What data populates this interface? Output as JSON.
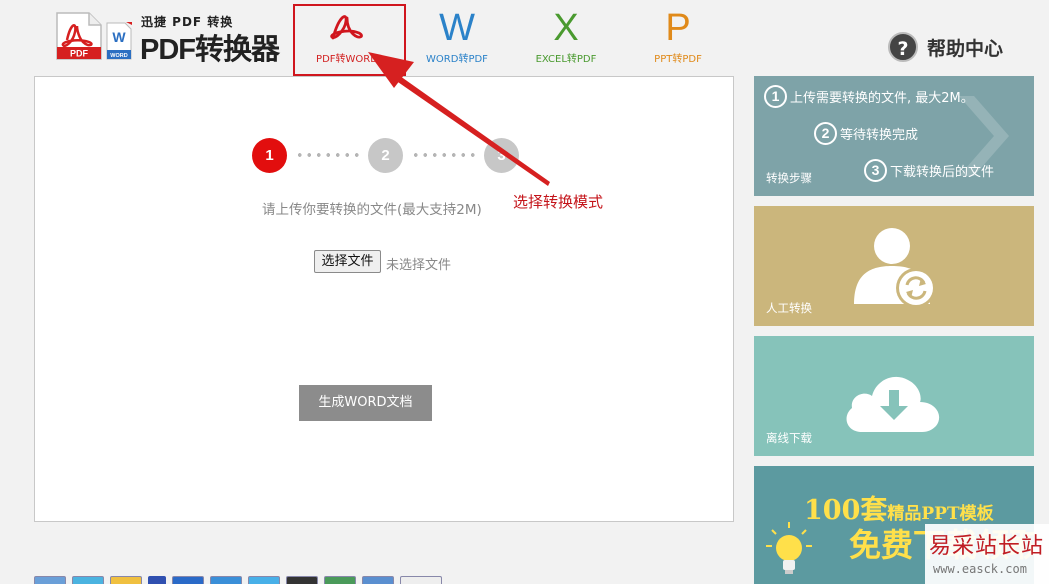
{
  "logo": {
    "subtitle": "迅捷 PDF 转换",
    "title": "PDF转换器",
    "pdf_badge": "PDF",
    "word_badge": "WORD"
  },
  "tabs": [
    {
      "glyph": "W",
      "label": "WORD转PDF"
    },
    {
      "glyph": "X",
      "label": "EXCEL转PDF"
    },
    {
      "glyph": "P",
      "label": "PPT转PDF"
    }
  ],
  "selected_tab": {
    "label": "PDF转WORD"
  },
  "help": {
    "icon_text": "?",
    "label": "帮助中心"
  },
  "steps": [
    "1",
    "2",
    "3"
  ],
  "upload": {
    "hint": "请上传你要转换的文件(最大支持2M)",
    "file_button": "选择文件",
    "file_status": "未选择文件",
    "generate_button": "生成WORD文档"
  },
  "annotation": "选择转换模式",
  "sidebar": {
    "steps_card": {
      "label": "转换步骤",
      "lines": [
        {
          "num": "1",
          "text": "上传需要转换的文件, 最大2M。"
        },
        {
          "num": "2",
          "text": "等待转换完成"
        },
        {
          "num": "3",
          "text": "下载转换后的文件"
        }
      ]
    },
    "manual_card": {
      "label": "人工转换"
    },
    "offline_card": {
      "label": "离线下载"
    },
    "promo_card": {
      "count": "100套",
      "small": "精品PPT模板",
      "big": "免费下载领取"
    }
  },
  "watermark": {
    "cn": "易采站长站",
    "url": "www.easck.com"
  },
  "colors": {
    "accent_red": "#d0161e",
    "word_blue": "#2b82c9",
    "excel_green": "#4a9a2f",
    "ppt_orange": "#e08a1a"
  }
}
